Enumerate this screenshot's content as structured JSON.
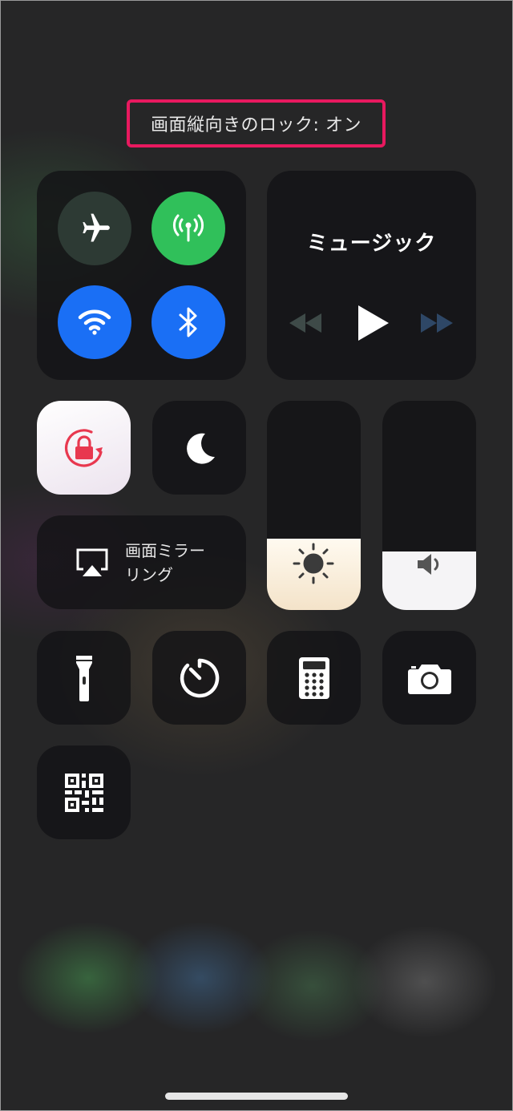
{
  "banner": {
    "text": "画面縦向きのロック: オン"
  },
  "music": {
    "title": "ミュージック"
  },
  "screen_mirroring": {
    "line1": "画面ミラー",
    "line2": "リング"
  },
  "brightness": {
    "level": 0.34
  },
  "volume": {
    "level": 0.28
  },
  "colors": {
    "highlight": "#e8195f",
    "cellular": "#30c05a",
    "wifi": "#1a6ff5",
    "bluetooth": "#1a6ff5",
    "lock": "#e8384f"
  },
  "icons": [
    "airplane-icon",
    "cellular-icon",
    "wifi-icon",
    "bluetooth-icon",
    "rewind-icon",
    "play-icon",
    "fast-forward-icon",
    "orientation-lock-icon",
    "moon-icon",
    "screen-mirroring-icon",
    "sun-icon",
    "speaker-icon",
    "flashlight-icon",
    "timer-icon",
    "calculator-icon",
    "camera-icon",
    "qr-code-icon"
  ]
}
